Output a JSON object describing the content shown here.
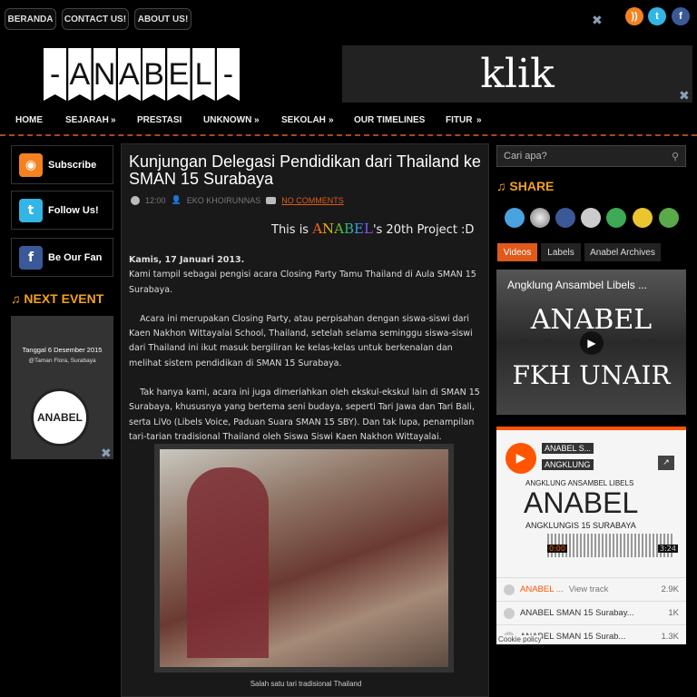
{
  "topbar": {
    "links": [
      "BERANDA",
      "CONTACT US!",
      "ABOUT US!"
    ]
  },
  "header": {
    "logo_letters": [
      "-",
      "A",
      "N",
      "A",
      "B",
      "E",
      "L",
      "-"
    ],
    "banner_text": "klik"
  },
  "nav": {
    "items": [
      "HOME",
      "SEJARAH",
      "PRESTASI",
      "UNKNOWN",
      "SEKOLAH",
      "OUR TIMELINES",
      "FITUR"
    ],
    "chevron": "»"
  },
  "sidebar": {
    "subscribe": "Subscribe",
    "follow": "Follow Us!",
    "fan": "Be Our Fan",
    "next_event_title": "NEXT EVENT",
    "event_date": "Tanggal 6 Desember 2015",
    "event_place": "@Taman Flora, Surabaya",
    "badge_text": "ANABEL"
  },
  "post": {
    "title": "Kunjungan Delegasi Pendidikan dari Thailand ke SMAN 15 Surabaya",
    "time": "12:00",
    "author": "EKO KHOIRUNNAS",
    "comments": "NO COMMENTS",
    "project_pre": "This is ",
    "project_brand": "ANABEL",
    "project_post": "'s 20th Project :D",
    "date_line": "Kamis, 17 Januari 2013.",
    "p1": "Kami tampil sebagai pengisi acara Closing Party Tamu Thailand di Aula SMAN 15 Surabaya.",
    "p2": "    Acara ini merupakan Closing Party, atau perpisahan dengan siswa-siswi dari Kaen Nakhon Wittayalai School, Thailand, setelah selama seminggu siswa-siswi dari Thailand ini ikut masuk bergiliran ke kelas-kelas untuk berkenalan dan melihat sistem pendidikan di SMAN 15 Surabaya.",
    "p3": "    Tak hanya kami, acara ini juga dimeriahkan oleh ekskul-ekskul lain di SMAN 15 Surabaya, khususnya yang bertema seni budaya, seperti Tari Jawa dan Tari Bali, serta LiVo (Libels Voice, Paduan Suara SMAN 15 SBY). Dan tak lupa, penampilan tari-tarian tradisional Thailand oleh Siswa Siswi Kaen Nakhon Wittayalai.",
    "caption": "Salah satu tari tradisional Thailand"
  },
  "right": {
    "search_placeholder": "Cari apa?",
    "share_title": "SHARE",
    "tabs": [
      "Videos",
      "Labels",
      "Anabel Archives"
    ],
    "video_title": "Angklung Ansambel Libels ...",
    "video_big1": "ANABEL",
    "video_big2": "FKH UNAIR",
    "sc": {
      "user": "ANABEL S...",
      "name": "ANGKLUNG",
      "art_line1": "ANGKLUNG ANSAMBEL LIBELS",
      "art_big": "ANABEL",
      "art_line2": "ANGKLUNGIS  15  SURABAYA",
      "t_start": "0:00",
      "t_end": "3:24",
      "rows": [
        {
          "title": "ANABEL ...",
          "extra": "View track",
          "count": "2.9K"
        },
        {
          "title": "ANABEL SMAN 15 Surabay...",
          "extra": "",
          "count": "1K"
        },
        {
          "title": "ANABEL SMAN 15 Surab...",
          "extra": "",
          "count": "1.3K"
        }
      ],
      "cookie": "Cookie policy"
    }
  }
}
